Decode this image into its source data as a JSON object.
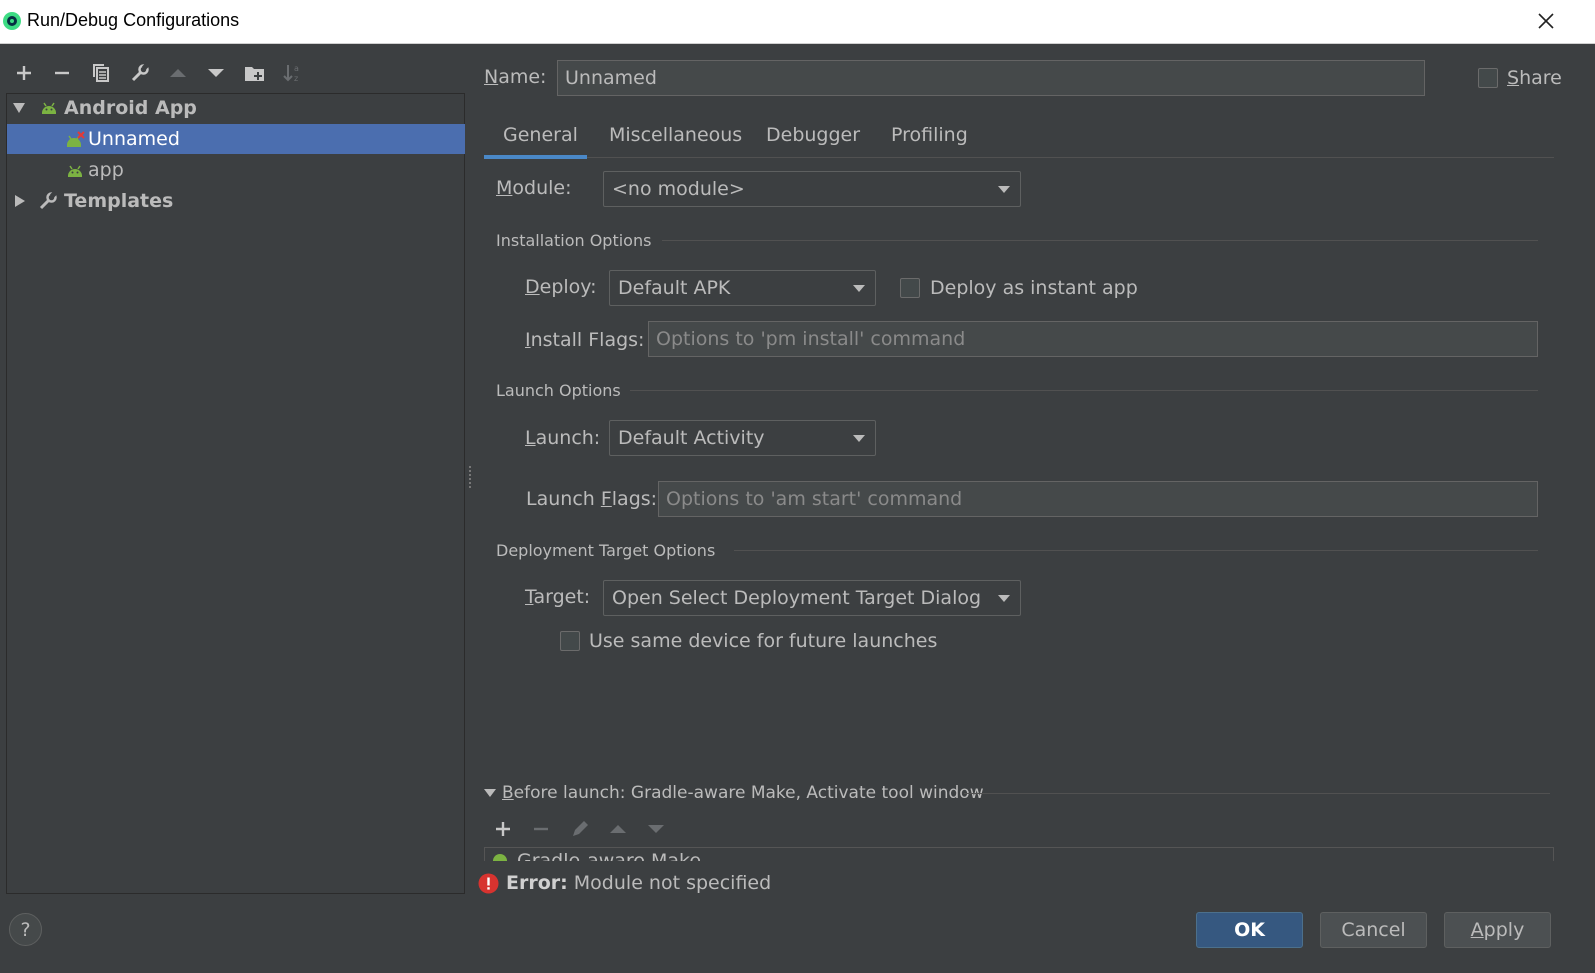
{
  "window": {
    "title": "Run/Debug Configurations"
  },
  "tree": {
    "items": [
      {
        "label": "Android App"
      },
      {
        "label": "Unnamed"
      },
      {
        "label": "app"
      },
      {
        "label": "Templates"
      }
    ]
  },
  "toolbar_icons": [
    "add-icon",
    "remove-icon",
    "copy-icon",
    "wrench-icon",
    "move-up-icon",
    "move-down-icon",
    "new-folder-icon",
    "sort-icon"
  ],
  "name": {
    "label_pre": "",
    "label_ul": "N",
    "label_post": "ame:",
    "value": "Unnamed"
  },
  "share": {
    "label_ul": "S",
    "label_post": "hare"
  },
  "tabs": [
    "General",
    "Miscellaneous",
    "Debugger",
    "Profiling"
  ],
  "module": {
    "label_ul": "M",
    "label_post": "odule:",
    "value": "<no module>"
  },
  "installation": {
    "title": "Installation Options",
    "deploy_ul": "D",
    "deploy_post": "eploy:",
    "deploy_value": "Default APK",
    "instant_label": "Deploy as instant app",
    "flags_ul": "I",
    "flags_post": "nstall Flags:",
    "flags_placeholder": "Options to 'pm install' command"
  },
  "launch": {
    "title": "Launch Options",
    "launch_ul": "L",
    "launch_post": "aunch:",
    "launch_value": "Default Activity",
    "flags_pre": "Launch ",
    "flags_ul": "F",
    "flags_post": "lags:",
    "flags_placeholder": "Options to 'am start' command"
  },
  "deployment": {
    "title": "Deployment Target Options",
    "target_ul": "T",
    "target_post": "arget:",
    "target_value": "Open Select Deployment Target Dialog",
    "same_device_label": "Use same device for future launches"
  },
  "before_launch": {
    "title_ul": "B",
    "title_post": "efore launch: Gradle-aware Make, Activate tool window",
    "item": "Gradle-aware Make"
  },
  "error": {
    "bold": "Error:",
    "text": " Module not specified"
  },
  "buttons": {
    "ok": "OK",
    "cancel": "Cancel",
    "apply_ul": "A",
    "apply_post": "pply"
  },
  "help": "?",
  "colors": {
    "selection": "#4b6eaf",
    "android_green": "#7cb342",
    "error_red": "#d7332f",
    "ok_button": "#365880"
  }
}
